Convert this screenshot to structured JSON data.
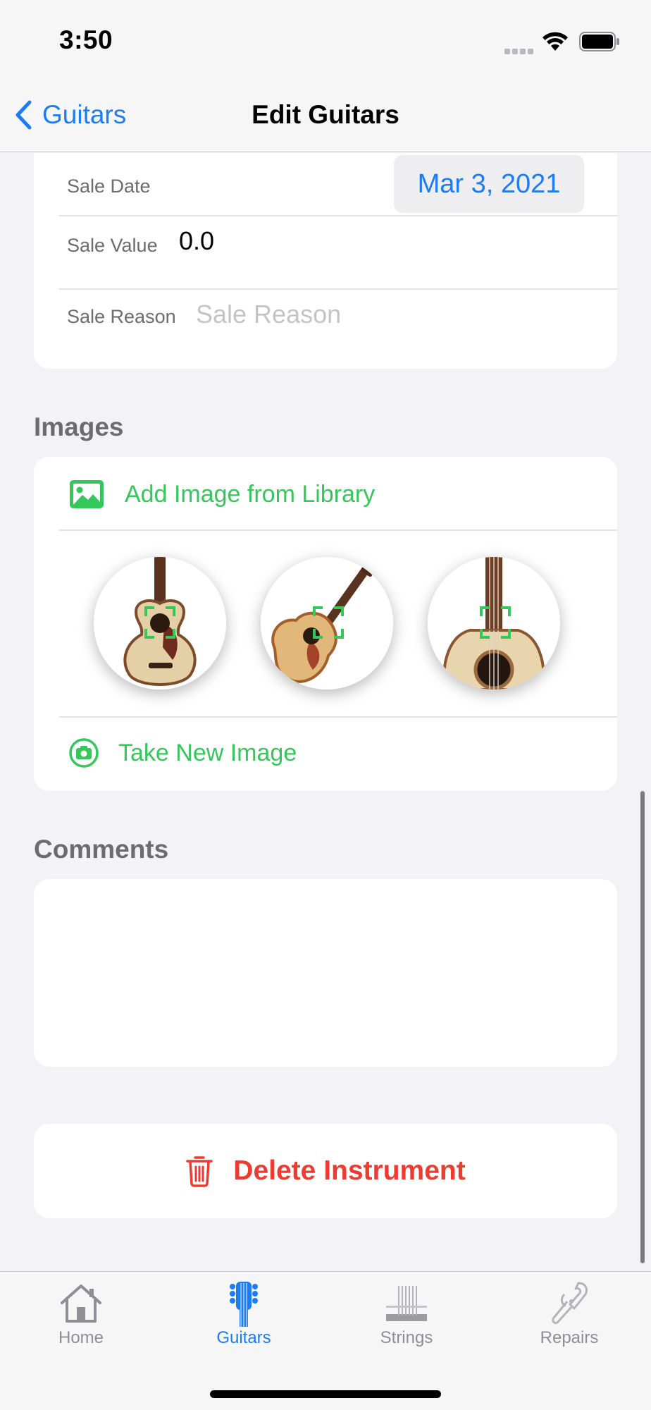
{
  "status_bar": {
    "time": "3:50"
  },
  "nav": {
    "back_label": "Guitars",
    "title": "Edit Guitars"
  },
  "sale": {
    "date_label": "Sale Date",
    "date_value": "Mar 3, 2021",
    "value_label": "Sale Value",
    "value": "0.0",
    "reason_label": "Sale Reason",
    "reason_placeholder": "Sale Reason",
    "reason_value": ""
  },
  "images": {
    "header": "Images",
    "add_from_library": "Add Image from Library",
    "take_new": "Take New Image",
    "thumbnails": [
      {
        "icon": "guitar-photo-1"
      },
      {
        "icon": "guitar-photo-2"
      },
      {
        "icon": "guitar-photo-3"
      }
    ]
  },
  "comments": {
    "header": "Comments",
    "value": ""
  },
  "delete": {
    "label": "Delete Instrument"
  },
  "tabs": [
    {
      "label": "Home",
      "icon": "house-icon",
      "active": false
    },
    {
      "label": "Guitars",
      "icon": "guitar-icon",
      "active": true
    },
    {
      "label": "Strings",
      "icon": "strings-icon",
      "active": false
    },
    {
      "label": "Repairs",
      "icon": "repairs-icon",
      "active": false
    }
  ],
  "colors": {
    "accent": "#1c7cf4",
    "green": "#34c759",
    "destructive": "#ee3b30",
    "background": "#f2f2f7",
    "secondary_text": "#6c6c70"
  }
}
